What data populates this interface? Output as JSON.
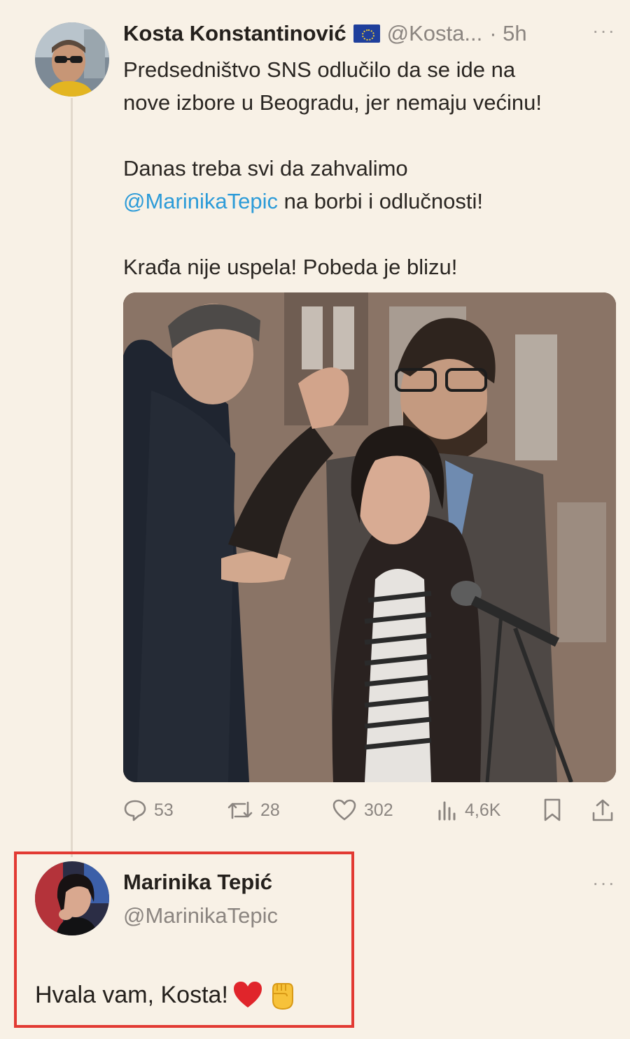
{
  "tweet": {
    "author_name": "Kosta Konstantinović",
    "flag_icon": "eu-flag-icon",
    "handle": "@Kosta...",
    "time": "· 5h",
    "more": "···",
    "paragraphs": {
      "p1_line1": "Predsedništvo SNS odlučilo da se ide na",
      "p1_line2": "nove izbore u Beogradu, jer nemaju većinu!",
      "p2_line1": "Danas treba svi da zahvalimo",
      "p2_mention": "@MarinikaTepic",
      "p2_rest": " na borbi i odlučnosti!",
      "p3": "Krađa nije uspela! Pobeda je blizu!"
    },
    "stats": {
      "replies": "53",
      "retweets": "28",
      "likes": "302",
      "views": "4,6K"
    }
  },
  "reply": {
    "author_name": "Marinika Tepić",
    "handle": "@MarinikaTepic",
    "more": "···",
    "text": "Hvala vam, Kosta!",
    "emojis": [
      "red-heart-icon",
      "raised-fist-icon"
    ]
  },
  "colors": {
    "background": "#f8f1e6",
    "mention": "#2c9bd8",
    "highlight_border": "#e23a33",
    "muted": "#8b8580"
  }
}
